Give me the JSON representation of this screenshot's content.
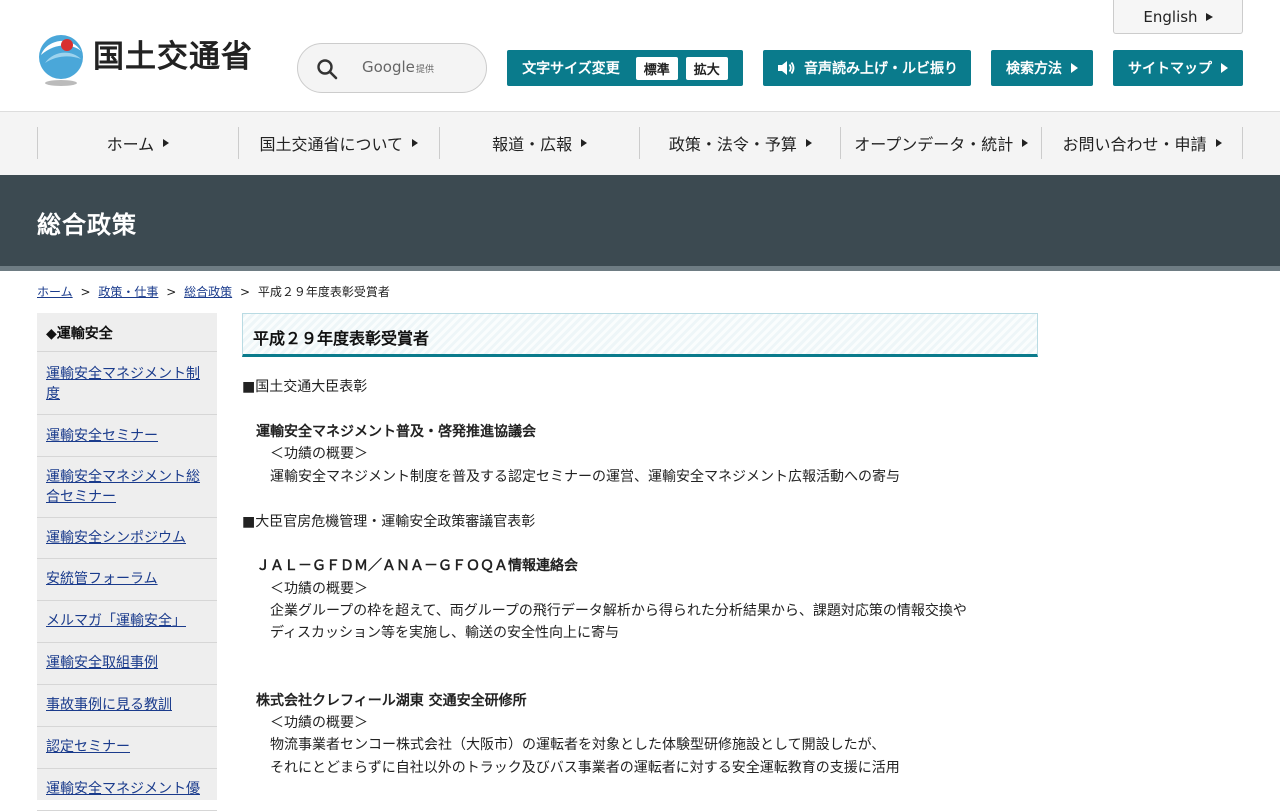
{
  "header": {
    "site_name": "国土交通省",
    "english_label": "English",
    "search": {
      "google": "Google",
      "provided": "提供"
    },
    "font_size": {
      "label": "文字サイズ変更",
      "standard": "標準",
      "large": "拡大"
    },
    "speech_label": "音声読み上げ・ルビ振り",
    "search_method_label": "検索方法",
    "sitemap_label": "サイトマップ"
  },
  "nav": {
    "items": [
      "ホーム",
      "国土交通省について",
      "報道・広報",
      "政策・法令・予算",
      "オープンデータ・統計",
      "お問い合わせ・申請"
    ]
  },
  "banner": {
    "title": "総合政策"
  },
  "breadcrumb": {
    "home": "ホーム",
    "policy": "政策・仕事",
    "general": "総合政策",
    "current": "平成２９年度表彰受賞者",
    "sep": ">"
  },
  "side": {
    "heading": "◆運輸安全",
    "items": [
      "運輸安全マネジメント制度",
      "運輸安全セミナー",
      "運輸安全マネジメント総合セミナー",
      "運輸安全シンポジウム",
      "安統管フォーラム",
      "メルマガ「運輸安全」",
      "運輸安全取組事例",
      "事故事例に見る教訓",
      "認定セミナー",
      "運輸安全マネジメント優"
    ]
  },
  "main": {
    "title": "平成２９年度表彰受賞者",
    "sec1_heading": "■国土交通大臣表彰",
    "award1_name": "運輸安全マネジメント普及・啓発推進協議会",
    "award1_overview": "＜功績の概要＞",
    "award1_desc": "運輸安全マネジメント制度を普及する認定セミナーの運営、運輸安全マネジメント広報活動への寄与",
    "sec2_heading": "■大臣官房危機管理・運輸安全政策審議官表彰",
    "award2_name": "ＪＡＬ－ＧＦＤＭ／ＡＮＡ－ＧＦＯＱＡ情報連絡会",
    "award2_overview": "＜功績の概要＞",
    "award2_desc1": "企業グループの枠を超えて、両グループの飛行データ解析から得られた分析結果から、課題対応策の情報交換や",
    "award2_desc2": "ディスカッション等を実施し、輸送の安全性向上に寄与",
    "award3_name": "株式会社クレフィール湖東 交通安全研修所",
    "award3_overview": "＜功績の概要＞",
    "award3_desc1": "物流事業者センコー株式会社（大阪市）の運転者を対象とした体験型研修施設として開設したが、",
    "award3_desc2": "それにとどまらずに自社以外のトラック及びバス事業者の運転者に対する安全運転教育の支援に活用"
  }
}
